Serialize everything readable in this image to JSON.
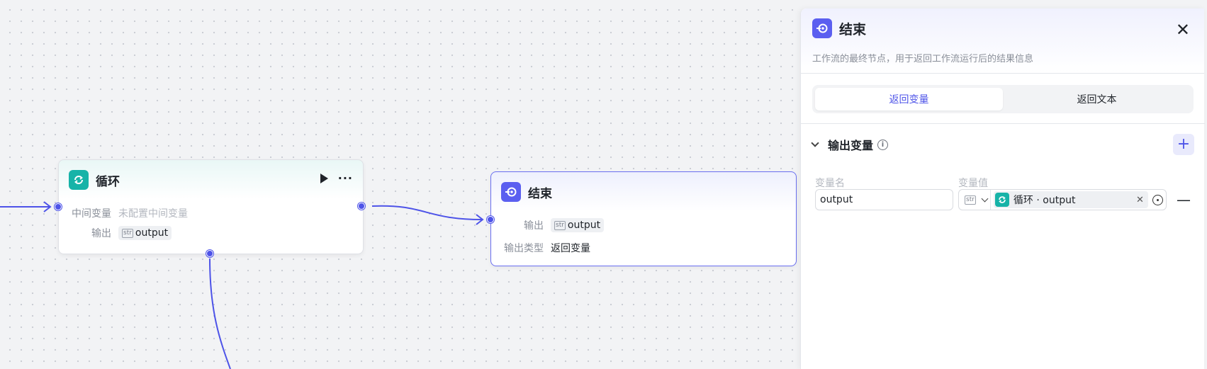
{
  "canvas": {
    "loop_node": {
      "title": "循环",
      "rows": [
        {
          "label": "中间变量",
          "value": "未配置中间变量"
        },
        {
          "label": "输出",
          "value": "output"
        }
      ]
    },
    "end_node": {
      "title": "结束",
      "rows": [
        {
          "label": "输出",
          "value": "output"
        },
        {
          "label": "输出类型",
          "value": "返回变量"
        }
      ]
    },
    "type_badge": "str",
    "accent_color": "#4d53e8",
    "loop_color": "#17b3a8"
  },
  "panel": {
    "title": "结束",
    "description": "工作流的最终节点，用于返回工作流运行后的结果信息",
    "tabs": [
      {
        "label": "返回变量",
        "active": true
      },
      {
        "label": "返回文本",
        "active": false
      }
    ],
    "section": {
      "title": "输出变量",
      "col_name": "变量名",
      "col_value": "变量值",
      "row": {
        "name_value": "output",
        "type": "str",
        "ref_label": "循环 · output"
      }
    }
  }
}
